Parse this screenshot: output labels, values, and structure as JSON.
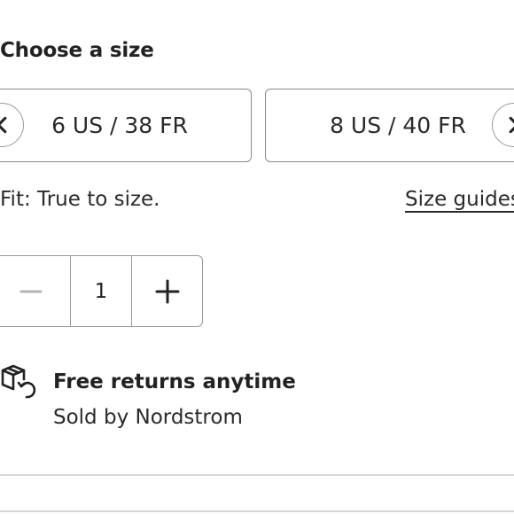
{
  "size_selector": {
    "title": "Choose a size",
    "options": [
      {
        "label": "6 US / 38 FR"
      },
      {
        "label": "8 US / 40 FR"
      }
    ],
    "prev_icon": "chevron-left-icon",
    "next_icon": "chevron-right-icon"
  },
  "fit": {
    "text": "Fit: True to size.",
    "size_guides_link": "Size guides"
  },
  "quantity": {
    "value": "1",
    "decrement_icon": "minus-icon",
    "increment_icon": "plus-icon",
    "decrement_color": "#b5b5b5",
    "increment_color": "#222222"
  },
  "shipping": {
    "icon": "box-return-icon",
    "title": "Free returns anytime",
    "sold_by": "Sold by Nordstrom"
  }
}
